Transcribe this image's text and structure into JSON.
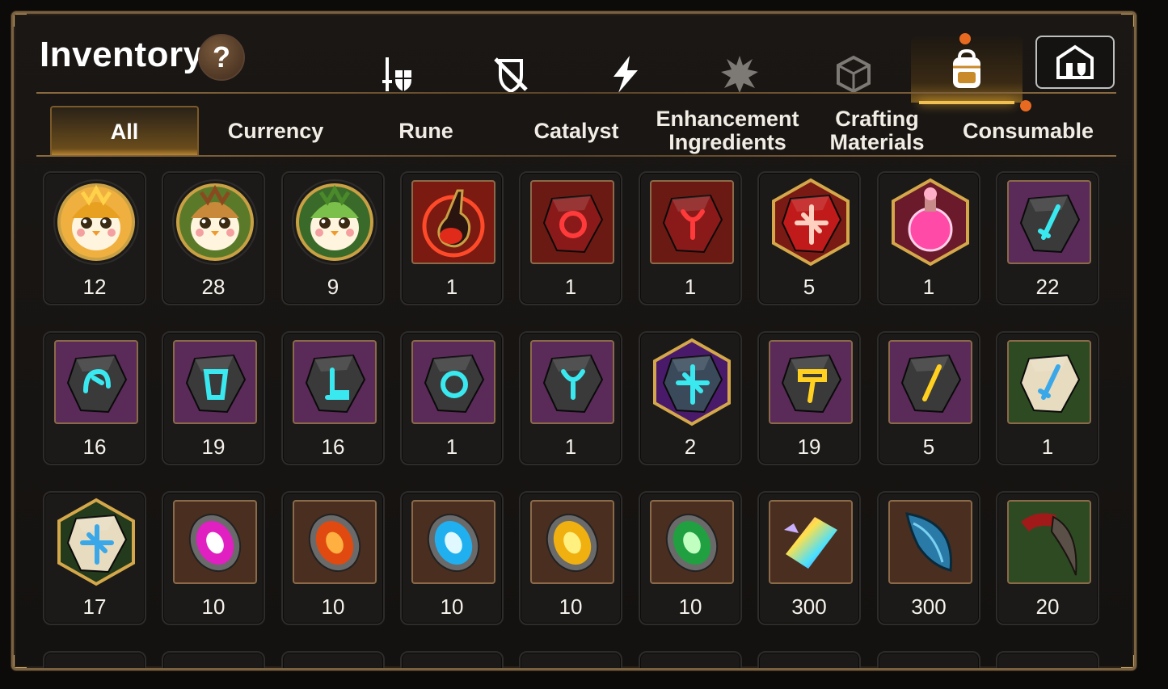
{
  "header": {
    "title": "Inventory",
    "help_label": "?"
  },
  "category_tabs": [
    {
      "icon": "sword-shield-icon",
      "active": false
    },
    {
      "icon": "no-gear-icon",
      "active": false
    },
    {
      "icon": "lightning-icon",
      "active": false
    },
    {
      "icon": "spiky-crest-icon",
      "active": false
    },
    {
      "icon": "cube-icon",
      "active": false
    },
    {
      "icon": "backpack-icon",
      "active": true,
      "notification": true
    },
    {
      "icon": "storage-house-icon",
      "active": false
    }
  ],
  "sub_tabs": [
    {
      "label": "All",
      "active": true
    },
    {
      "label": "Currency",
      "active": false
    },
    {
      "label": "Rune",
      "active": false
    },
    {
      "label": "Catalyst",
      "active": false
    },
    {
      "label": "Enhancement\nIngredients",
      "active": false
    },
    {
      "label": "Crafting\nMaterials",
      "active": false
    },
    {
      "label": "Consumable",
      "active": false,
      "notification": true
    }
  ],
  "items": [
    {
      "kind": "penguin-gold",
      "quantity": "12"
    },
    {
      "kind": "penguin-brown",
      "quantity": "28"
    },
    {
      "kind": "penguin-green",
      "quantity": "9"
    },
    {
      "kind": "red-potion",
      "quantity": "1"
    },
    {
      "kind": "red-ring-gem",
      "quantity": "1"
    },
    {
      "kind": "red-necklace-gem",
      "quantity": "1"
    },
    {
      "kind": "red-star-gem-hex",
      "quantity": "5"
    },
    {
      "kind": "pink-potion-hex",
      "quantity": "1"
    },
    {
      "kind": "purple-sword-gem",
      "quantity": "22"
    },
    {
      "kind": "purple-helmet-gem",
      "quantity": "16"
    },
    {
      "kind": "purple-armor-gem",
      "quantity": "19"
    },
    {
      "kind": "purple-boot-gem",
      "quantity": "16"
    },
    {
      "kind": "purple-ring-gem",
      "quantity": "1"
    },
    {
      "kind": "purple-necklace-gem",
      "quantity": "1"
    },
    {
      "kind": "purple-star-gem-hex",
      "quantity": "2"
    },
    {
      "kind": "purple-hammer-gem",
      "quantity": "19"
    },
    {
      "kind": "purple-pencil-gem",
      "quantity": "5"
    },
    {
      "kind": "green-sword-stone",
      "quantity": "1"
    },
    {
      "kind": "green-star-stone-hex",
      "quantity": "17"
    },
    {
      "kind": "pink-rune-coin",
      "quantity": "10"
    },
    {
      "kind": "orange-rune-coin",
      "quantity": "10"
    },
    {
      "kind": "blue-rune-coin",
      "quantity": "10"
    },
    {
      "kind": "yellow-rune-coin",
      "quantity": "10"
    },
    {
      "kind": "green-rune-coin",
      "quantity": "10"
    },
    {
      "kind": "rainbow-crystal",
      "quantity": "300"
    },
    {
      "kind": "blue-scale-claw",
      "quantity": "300"
    },
    {
      "kind": "red-claw-fang",
      "quantity": "20"
    }
  ],
  "colors": {
    "accent_gold": "#f0c050",
    "frame_bronze": "#7a6240",
    "notification_orange": "#e86a20",
    "rarity_red": "#6a1a12",
    "rarity_purple": "#5a2a58",
    "rarity_green": "#2e4a22",
    "rarity_brown": "#4a2e20"
  }
}
